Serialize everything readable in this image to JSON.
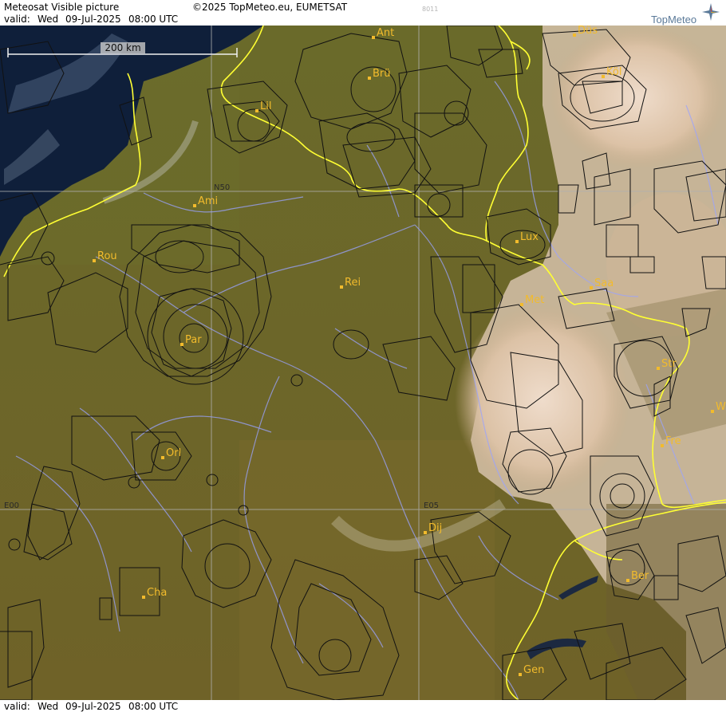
{
  "header": {
    "title": "Meteosat Visible picture",
    "copyright": "©2025 TopMeteo.eu, EUMETSAT",
    "valid_label": "valid:",
    "valid_day": "Wed",
    "valid_date": "09-Jul-2025",
    "valid_time": "08:00 UTC",
    "code": "8011",
    "brand": "TopMeteo",
    "logo_icon": "compass-star-icon"
  },
  "footer": {
    "valid_label": "valid:",
    "valid_day": "Wed",
    "valid_date": "09-Jul-2025",
    "valid_time": "08:00 UTC"
  },
  "map": {
    "scale_label": "200 km",
    "grid_labels": {
      "lat": "N50",
      "lon_west": "E00",
      "lon_east": "E05"
    },
    "cities": [
      "Ant",
      "Düs",
      "Brü",
      "Köl",
      "Lil",
      "Ami",
      "Lux",
      "Rou",
      "Rei",
      "Saa",
      "Met",
      "Par",
      "Str",
      "W",
      "Fre",
      "Orl",
      "Dij",
      "Ber",
      "Cha",
      "Gen"
    ],
    "colors": {
      "city_label": "#f2bb2c",
      "border": "#ffff33",
      "rivers": "#9aa3ff",
      "airspace": "#111111",
      "land": "#6e6b2b",
      "sea": "#0f1f3a",
      "cloud": "#e8d6c0"
    }
  }
}
